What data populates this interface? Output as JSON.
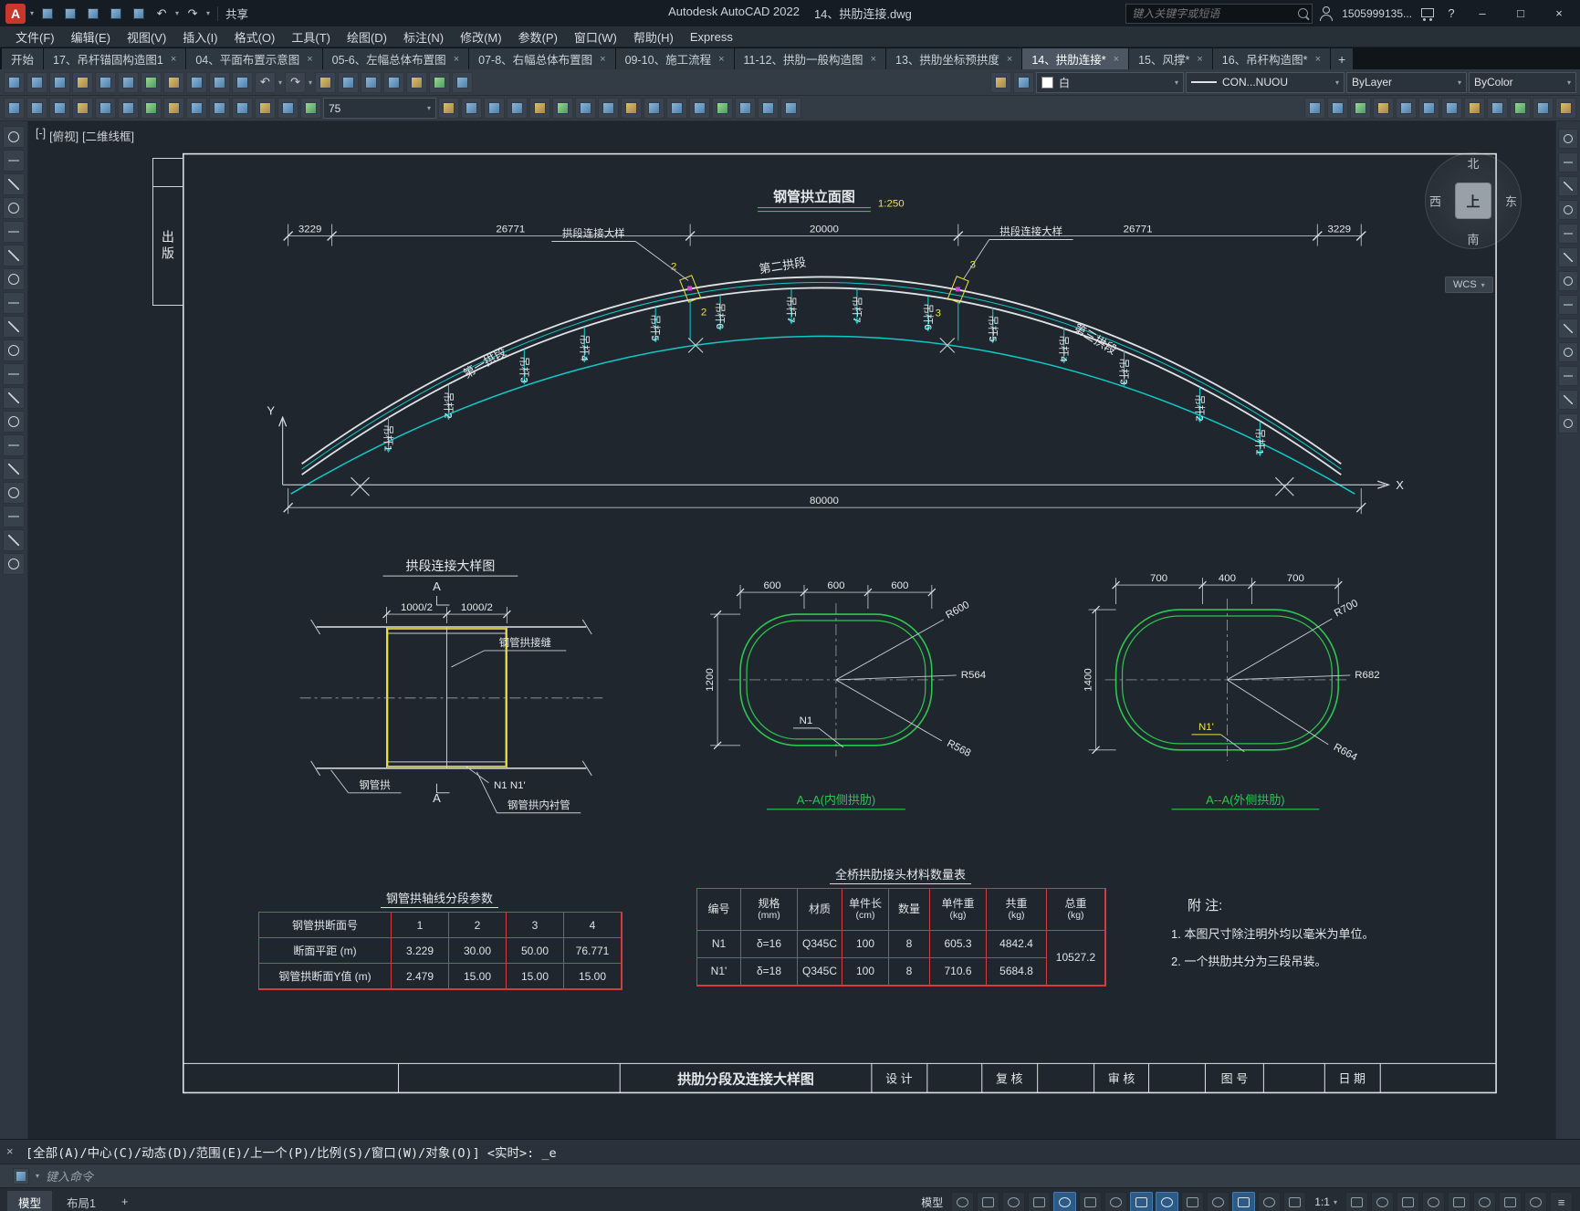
{
  "ui": {
    "close": "×",
    "caret": "▾",
    "plus": "+",
    "minimize": "–",
    "maximize": "□",
    "help": "?",
    "undo": "↶",
    "redo": "↷",
    "menu": "≡"
  },
  "titlebar": {
    "logo": "A",
    "share": "共享",
    "app_title": "Autodesk AutoCAD 2022",
    "doc_title": "14、拱肋连接.dwg",
    "search_placeholder": "键入关键字或短语",
    "user": "1505999135..."
  },
  "menubar": {
    "items": [
      "文件(F)",
      "编辑(E)",
      "视图(V)",
      "插入(I)",
      "格式(O)",
      "工具(T)",
      "绘图(D)",
      "标注(N)",
      "修改(M)",
      "参数(P)",
      "窗口(W)",
      "帮助(H)",
      "Express"
    ]
  },
  "tabs": {
    "items": [
      "开始",
      "17、吊杆锚固构造图1",
      "04、平面布置示意图",
      "05-6、左幅总体布置图",
      "07-8、右幅总体布置图",
      "09-10、施工流程",
      "11-12、拱肋一般构造图",
      "13、拱肋坐标预拱度",
      "14、拱肋连接*",
      "15、风撑*",
      "16、吊杆构造图*"
    ]
  },
  "toolbar": {
    "layer": "白",
    "linetype": "CON...NUOU",
    "bylayer": "ByLayer",
    "bycolor": "ByColor",
    "offset": "75"
  },
  "viewport": {
    "controls": [
      "[-]",
      "[俯视]",
      "[二维线框]"
    ]
  },
  "viewcube": {
    "n": "北",
    "s": "南",
    "w": "西",
    "e": "东",
    "top": "上",
    "wcs": "WCS"
  },
  "sheet": {
    "publish": "出版"
  },
  "arch": {
    "title": "钢管拱立面图",
    "scale": "1:250",
    "dims_top": [
      "3229",
      "26771",
      "20000",
      "26771",
      "3229"
    ],
    "dim_bottom": "80000",
    "callout": "拱段连接大样",
    "segments": [
      "第一拱段",
      "第二拱段",
      "第三拱段"
    ],
    "marks": [
      "2",
      "3"
    ],
    "axis_x": "X",
    "axis_y": "Y",
    "hangers_left": [
      "吊杆1",
      "吊杆2",
      "吊杆3",
      "吊杆4",
      "吊杆5",
      "吊杆6",
      "吊杆7"
    ],
    "hangers_right": [
      "吊杆7",
      "吊杆6",
      "吊杆5",
      "吊杆4",
      "吊杆3",
      "吊杆2",
      "吊杆1"
    ]
  },
  "detail": {
    "title": "拱段连接大样图",
    "section_letter": "A",
    "dims": [
      "1000/2",
      "1000/2"
    ],
    "label_joint": "钢管拱接缝",
    "label_pipe": "钢管拱",
    "label_n": "N1 N1'",
    "label_liner": "钢管拱内衬管"
  },
  "sec_inner": {
    "dims": [
      "600",
      "600",
      "600"
    ],
    "height": "1200",
    "radii": [
      "R600",
      "R564",
      "R568"
    ],
    "bar": "N1",
    "title": "A--A(内侧拱肋)"
  },
  "sec_outer": {
    "dims": [
      "700",
      "400",
      "700"
    ],
    "height": "1400",
    "radii": [
      "R700",
      "R682",
      "R664"
    ],
    "bar": "N1'",
    "title": "A--A(外侧拱肋)"
  },
  "ptable": {
    "title": "钢管拱轴线分段参数",
    "rows": [
      {
        "label": "钢管拱断面号",
        "v1": "1",
        "v2": "2",
        "v3": "3",
        "v4": "4"
      },
      {
        "label": "断面平距 (m)",
        "v1": "3.229",
        "v2": "30.00",
        "v3": "50.00",
        "v4": "76.771"
      },
      {
        "label": "钢管拱断面Y值 (m)",
        "v1": "2.479",
        "v2": "15.00",
        "v3": "15.00",
        "v4": "15.00"
      }
    ]
  },
  "mtable": {
    "title": "全桥拱肋接头材料数量表",
    "headers": [
      {
        "a": "编号",
        "b": ""
      },
      {
        "a": "规格",
        "b": "(mm)"
      },
      {
        "a": "材质",
        "b": ""
      },
      {
        "a": "单件长",
        "b": "(cm)"
      },
      {
        "a": "数量",
        "b": ""
      },
      {
        "a": "单件重",
        "b": "(kg)"
      },
      {
        "a": "共重",
        "b": "(kg)"
      },
      {
        "a": "总重",
        "b": "(kg)"
      }
    ],
    "rows": [
      {
        "id": "N1",
        "spec": "δ=16",
        "mat": "Q345C",
        "len": "100",
        "qty": "8",
        "unit": "605.3",
        "sum": "4842.4"
      },
      {
        "id": "N1'",
        "spec": "δ=18",
        "mat": "Q345C",
        "len": "100",
        "qty": "8",
        "unit": "710.6",
        "sum": "5684.8"
      }
    ],
    "total": "10527.2"
  },
  "notes": {
    "title": "附 注:",
    "lines": [
      "1. 本图尺寸除注明外均以毫米为单位。",
      "2. 一个拱肋共分为三段吊装。"
    ]
  },
  "tblock": {
    "title": "拱肋分段及连接大样图",
    "design": "设 计",
    "check": "复 核",
    "audit": "审 核",
    "number": "图 号",
    "date": "日 期"
  },
  "cmd": {
    "history": "[全部(A)/中心(C)/动态(D)/范围(E)/上一个(P)/比例(S)/窗口(W)/对象(O)] <实时>: _e",
    "placeholder": "键入命令"
  },
  "status": {
    "model_tab": "模型",
    "layout_tab": "布局1",
    "model_space": "模型",
    "scale": "1:1"
  }
}
